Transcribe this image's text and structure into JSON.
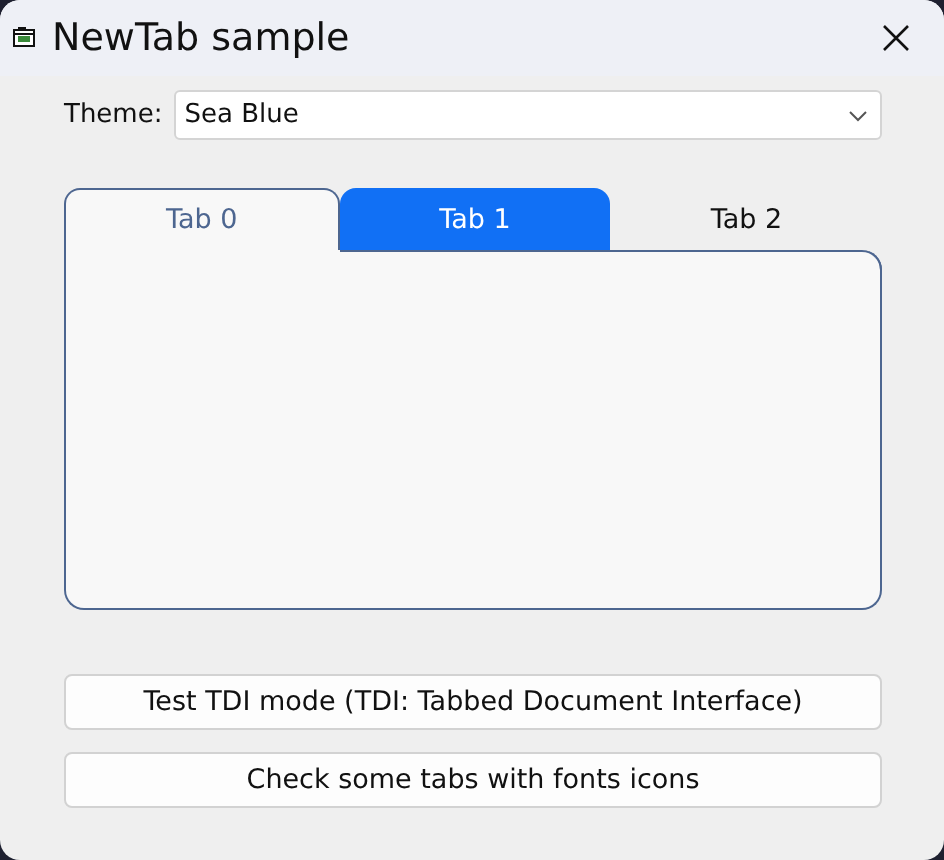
{
  "window": {
    "title": "NewTab sample"
  },
  "theme": {
    "label": "Theme:",
    "value": "Sea Blue"
  },
  "tabs": [
    {
      "label": "Tab 0",
      "selected": true,
      "highlighted": false
    },
    {
      "label": "Tab 1",
      "selected": false,
      "highlighted": true
    },
    {
      "label": "Tab 2",
      "selected": false,
      "highlighted": false
    }
  ],
  "buttons": [
    "Test TDI mode (TDI: Tabbed Document Interface)",
    "Check some tabs with fonts icons"
  ]
}
